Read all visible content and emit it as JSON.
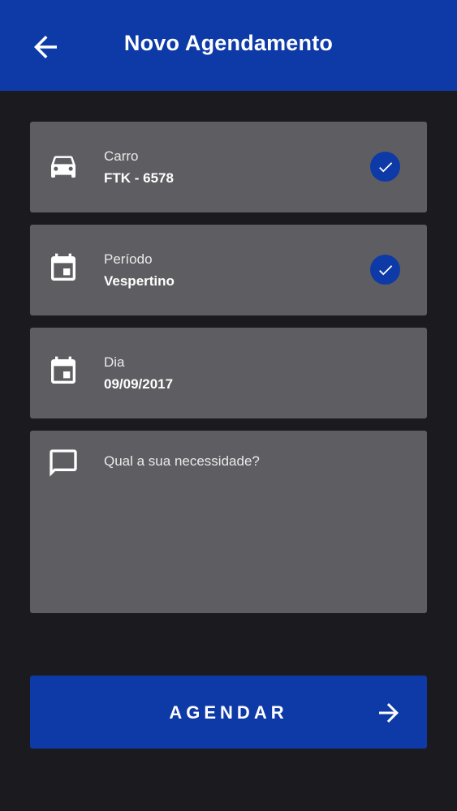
{
  "header": {
    "title": "Novo Agendamento",
    "back_icon": "arrow-left-icon",
    "background_color": "#0d3aa7"
  },
  "form": {
    "car": {
      "label": "Carro",
      "value": "FTK - 6578",
      "icon": "car-icon",
      "checked": true
    },
    "period": {
      "label": "Período",
      "value": "Vespertino",
      "icon": "calendar-icon",
      "checked": true
    },
    "day": {
      "label": "Dia",
      "value": "09/09/2017",
      "icon": "calendar-icon",
      "checked": false
    },
    "need": {
      "placeholder": "Qual a sua necessidade?",
      "value": "",
      "icon": "message-icon"
    }
  },
  "submit": {
    "label": "AGENDAR",
    "icon": "arrow-right-icon"
  },
  "colors": {
    "background": "#1b1b1f",
    "card": "#5e5e62",
    "accent": "#0d3aa7"
  }
}
